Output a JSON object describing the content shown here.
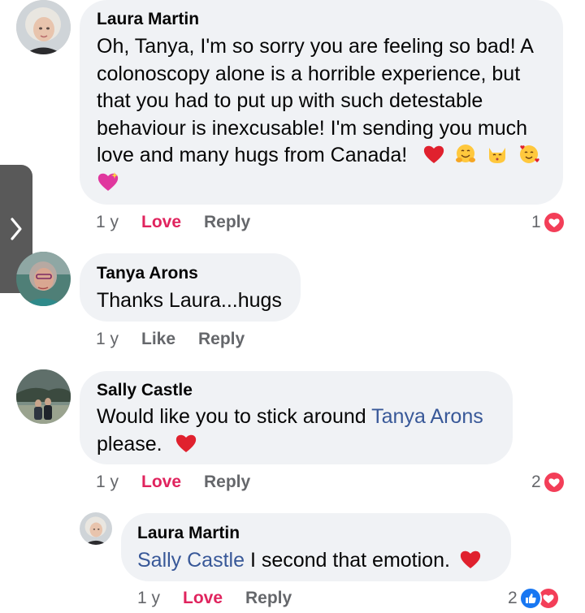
{
  "side_tab": {
    "icon": "chevron-right-icon"
  },
  "comments": [
    {
      "author": "Laura Martin",
      "lines": [
        "Oh, Tanya, I'm so sorry you are feeling so bad! A",
        "colonoscopy alone is a horrible experience, but",
        "that you had to put up with such detestable",
        "behaviour is inexcusable! I'm sending you much",
        "love and many hugs from Canada!"
      ],
      "emojis": [
        "red-heart-emoji",
        "hugging-face-emoji",
        "kissing-cat-emoji",
        "smiling-face-with-hearts-emoji",
        "sparkling-heart-emoji"
      ],
      "time": "1 y",
      "reaction_action": "Love",
      "reply": "Reply",
      "reaction_count": "1"
    },
    {
      "author": "Tanya Arons",
      "text": "Thanks Laura...hugs",
      "time": "1 y",
      "reaction_action": "Like",
      "reply": "Reply"
    },
    {
      "author": "Sally Castle",
      "text_before_mention": "Would like you to stick around ",
      "mention": "Tanya Arons",
      "text_line2": "please.",
      "emojis": [
        "red-heart-emoji"
      ],
      "time": "1 y",
      "reaction_action": "Love",
      "reply": "Reply",
      "reaction_count": "2"
    },
    {
      "author": "Laura Martin",
      "mention": "Sally Castle",
      "text": " I second that emotion.",
      "emojis": [
        "red-heart-emoji"
      ],
      "time": "1 y",
      "reaction_action": "Love",
      "reply": "Reply",
      "reaction_count": "2"
    }
  ]
}
